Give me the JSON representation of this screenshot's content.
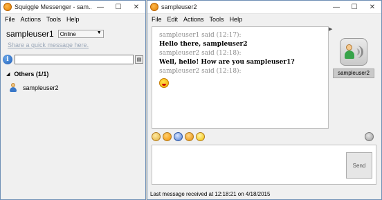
{
  "left_window": {
    "title": "Squiggle Messenger - sam...",
    "menu": [
      "File",
      "Actions",
      "Tools",
      "Help"
    ],
    "username": "sampleuser1",
    "status": "Online",
    "quick_message_placeholder": "Share a quick message here.",
    "search_value": "",
    "group": "Others (1/1)",
    "contacts": [
      {
        "name": "sampleuser2",
        "icon": "user-icon"
      }
    ]
  },
  "right_window": {
    "title": "sampleuser2",
    "menu": [
      "File",
      "Edit",
      "Actions",
      "Tools",
      "Help"
    ],
    "messages": [
      {
        "said": "sampleuser1 said (12:17):",
        "text": "Hello there, sampleuser2"
      },
      {
        "said": "sampleuser2 said (12:18):",
        "text": "Well, hello! How are you sampleuser1?"
      },
      {
        "said": "sampleuser2 said (12:18):",
        "text": ""
      }
    ],
    "avatar_label": "sampleuser2",
    "toolbar_icons": [
      "emoticon-icon",
      "nudge-icon",
      "file-icon",
      "wink-icon",
      "face-icon",
      "settings-icon"
    ],
    "send_label": "Send",
    "status_bar": "Last message received at 12:18:21 on 4/18/2015"
  },
  "window_controls": {
    "minimize": "—",
    "maximize": "☐",
    "close": "✕"
  }
}
